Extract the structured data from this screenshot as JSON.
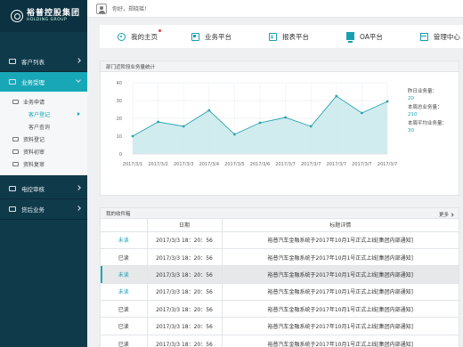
{
  "brand": {
    "name_cn": "裕普控股集团",
    "name_en": "HOLDING GROUP"
  },
  "header": {
    "greeting": "你好，郑晓瑶！"
  },
  "sidebar": {
    "items": [
      {
        "label": "客户列表"
      },
      {
        "label": "业务受理"
      },
      {
        "label": "电控审核"
      },
      {
        "label": "贷后业务"
      }
    ],
    "sub": {
      "business_apply": "业务申请",
      "customer_register": "客户登记",
      "customer_query": "客户查询",
      "material_register": "资料登记",
      "material_review": "资料初审",
      "material_recheck": "资料复审"
    }
  },
  "tabs": [
    {
      "label": "我的主页",
      "icon": "home-icon"
    },
    {
      "label": "业务平台",
      "icon": "business-icon"
    },
    {
      "label": "报表平台",
      "icon": "report-icon"
    },
    {
      "label": "OA平台",
      "icon": "monitor-icon"
    },
    {
      "label": "管理中心",
      "icon": "management-icon"
    }
  ],
  "chart_panel": {
    "title": "部门近阶段业务量统计",
    "stats": [
      {
        "label": "昨日业务量：",
        "value": "20"
      },
      {
        "label": "本周总业务量：",
        "value": "210"
      },
      {
        "label": "本周平均业务量：",
        "value": "30"
      }
    ]
  },
  "chart_data": {
    "type": "area",
    "x": [
      "2017/3/1",
      "2017/3/2",
      "2017/3/3",
      "2017/3/4",
      "2017/3/5",
      "2017/3/6",
      "2017/3/7",
      "2017/3/7",
      "2017/3/7",
      "2017/3/7",
      "2017/3/7"
    ],
    "values": [
      10,
      18,
      15.5,
      24.5,
      11,
      17.5,
      20.5,
      15.5,
      32.5,
      23,
      29.5
    ],
    "yticks": [
      0,
      10,
      20,
      30,
      40
    ],
    "ylim": [
      0,
      40
    ],
    "grid": true,
    "colors": {
      "line": "#2aa3ad",
      "fill": "#c9e9ec"
    }
  },
  "inbox": {
    "title": "我的收件箱",
    "more": "更多",
    "headers": [
      "日期",
      "标题详情"
    ],
    "rows": [
      {
        "status": "未读",
        "date": "2017/3/3  18：20：56",
        "title": "裕普汽车金融系统于2017年10月1号正式上线[集团内部通知]",
        "unread": true,
        "highlight": false
      },
      {
        "status": "已读",
        "date": "2017/3/3  18：20：56",
        "title": "裕普汽车金融系统于2017年10月1号正式上线[集团内部通知]",
        "unread": false,
        "highlight": false
      },
      {
        "status": "未读",
        "date": "2017/3/3  18：20：56",
        "title": "裕普汽车金融系统于2017年10月1号正式上线[集团内部通知]",
        "unread": true,
        "highlight": true
      },
      {
        "status": "未读",
        "date": "2017/3/3  18：20：56",
        "title": "裕普汽车金融系统于2017年10月1号正式上线[集团内部通知]",
        "unread": true,
        "highlight": false
      },
      {
        "status": "已读",
        "date": "2017/3/3  18：20：56",
        "title": "裕普汽车金融系统于2017年10月1号正式上线[集团内部通知]",
        "unread": false,
        "highlight": false
      },
      {
        "status": "已读",
        "date": "2017/3/3  18：20：56",
        "title": "裕普汽车金融系统于2017年10月1号正式上线[集团内部通知]",
        "unread": false,
        "highlight": false
      },
      {
        "status": "已读",
        "date": "2017/3/3  18：20：56",
        "title": "裕普汽车金融系统于2017年10月1号正式上线[集团内部通知]",
        "unread": false,
        "highlight": false
      }
    ]
  }
}
